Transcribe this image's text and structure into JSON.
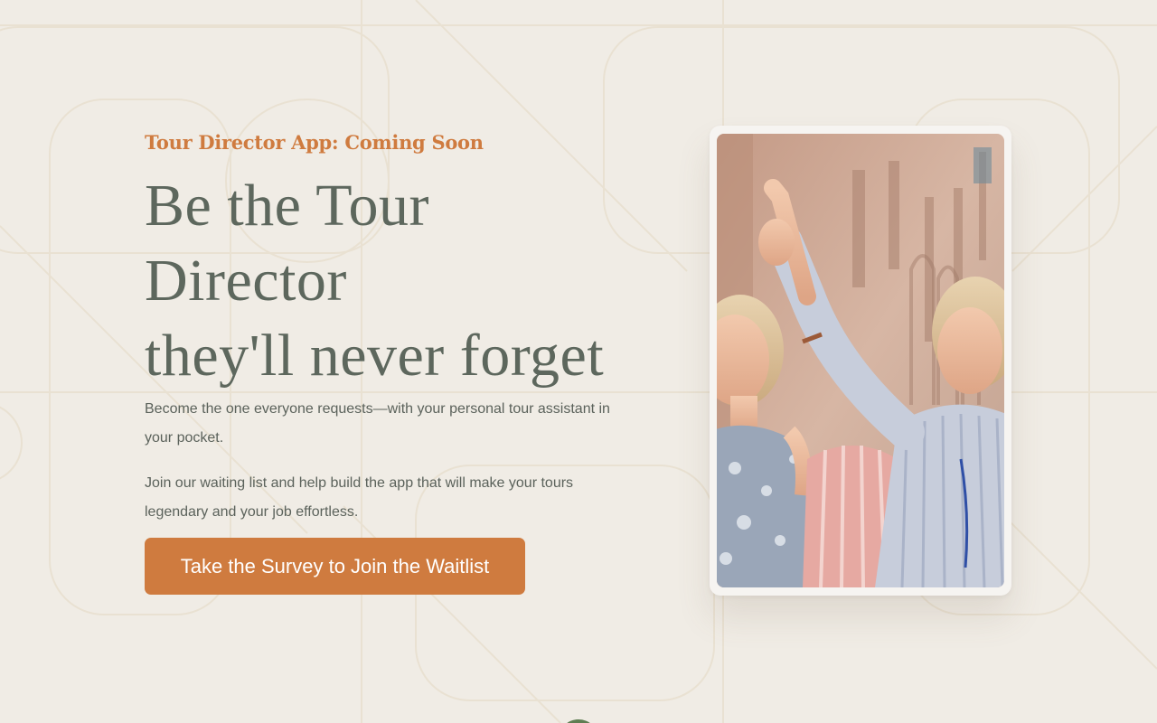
{
  "hero": {
    "eyebrow": "Tour Director App: Coming Soon",
    "headline_lines": [
      "Be the Tour",
      "Director",
      "they'll never forget"
    ],
    "paragraph_1": "Become the one everyone requests—with your personal tour assistant in your pocket.",
    "paragraph_2": "Join our waiting list and help build the app that will make your tours legendary and your job effortless.",
    "cta_label": "Take the Survey to Join the Waitlist"
  },
  "media": {
    "photo_subject": "tour-guide-pointing-photo"
  },
  "colors": {
    "background": "#f0ece5",
    "accent": "#cf7b3f",
    "headline": "#5d675d",
    "body": "#5b625b",
    "pattern_stroke": "#e9e1d2",
    "scroll_dot": "#5f7d52"
  }
}
